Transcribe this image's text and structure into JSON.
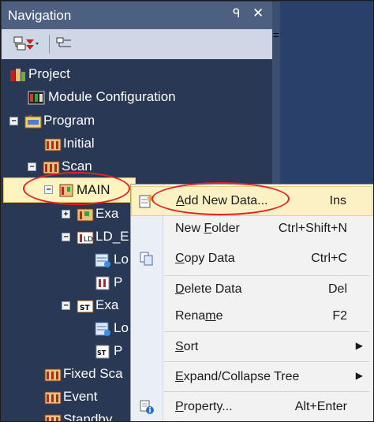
{
  "panel": {
    "title": "Navigation",
    "pin_glyph": "ᑫ",
    "close_glyph": "✕"
  },
  "toolbar": {
    "buttons": [
      "collapse-tree-icon",
      "expand-tree-icon"
    ]
  },
  "tree": {
    "project": "Project",
    "module_configuration": "Module Configuration",
    "program": "Program",
    "initial": "Initial",
    "scan": "Scan",
    "main": "MAIN",
    "exa1": "Exa",
    "ld_e": "LD_E",
    "lo1": "Lo",
    "p1": "P",
    "exa2": "Exa",
    "lo2": "Lo",
    "p2": "P",
    "fixed_scan": "Fixed Sca",
    "event": "Event",
    "standby": "Standby"
  },
  "context_menu": {
    "add_new_data": {
      "prefix": "",
      "ul": "A",
      "rest": "dd New Data...",
      "shortcut": "Ins"
    },
    "new_folder": {
      "prefix": "New ",
      "ul": "F",
      "rest": "older",
      "shortcut": "Ctrl+Shift+N"
    },
    "copy_data": {
      "prefix": "",
      "ul": "C",
      "rest": "opy Data",
      "shortcut": "Ctrl+C"
    },
    "delete_data": {
      "prefix": "",
      "ul": "D",
      "rest": "elete Data",
      "shortcut": "Del"
    },
    "rename": {
      "prefix": "Rena",
      "ul": "m",
      "rest": "e",
      "shortcut": "F2"
    },
    "sort": {
      "prefix": "",
      "ul": "S",
      "rest": "ort",
      "shortcut": ""
    },
    "expand_collapse": {
      "prefix": "",
      "ul": "E",
      "rest": "xpand/Collapse Tree",
      "shortcut": ""
    },
    "property": {
      "prefix": "",
      "ul": "P",
      "rest": "roperty...",
      "shortcut": "Alt+Enter"
    },
    "submenu_arrow": "▶"
  },
  "colors": {
    "panel_bg": "#293955",
    "highlight_bg": "#fcf1c5",
    "annotation_red": "#e0202a"
  }
}
